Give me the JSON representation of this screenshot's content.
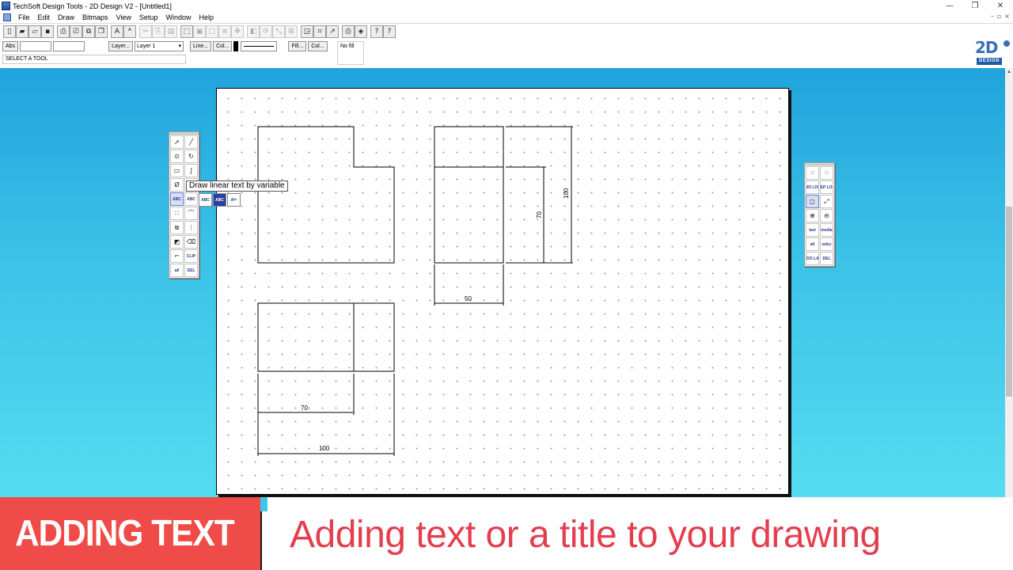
{
  "window": {
    "title": "TechSoft Design Tools - 2D Design V2 - [Untitled1]",
    "controls": [
      "—",
      "❐",
      "✕"
    ],
    "mdi_controls": [
      "–",
      "▫",
      "×"
    ]
  },
  "menu": [
    "File",
    "Edit",
    "Draw",
    "Bitmaps",
    "View",
    "Setup",
    "Window",
    "Help"
  ],
  "toolbar": {
    "icons": [
      "new-icon",
      "open-icon",
      "open-folder-icon",
      "save-icon",
      "print-icon",
      "print-preview-icon",
      "copy-view-icon",
      "copy-icon",
      "font-icon",
      "text-style-icon",
      "cut-icon",
      "copy-clip-icon",
      "paste-icon",
      "select-all-icon",
      "group-icon",
      "ungroup-icon",
      "align-icon",
      "move-icon",
      "mirror-icon",
      "rotate-icon",
      "scale-icon",
      "array-icon",
      "zoom-fit-icon",
      "grid-icon",
      "measure-icon",
      "print-setup-icon",
      "cad-icon",
      "context-help-icon",
      "help-icon"
    ]
  },
  "propbar": {
    "abs_label": "Abs",
    "layer_button": "Layer...",
    "layer_value": "Layer 1",
    "line_button": "Line...",
    "colour_button": "Col...",
    "fill_button": "Fill...",
    "fill_colour_button": "Col...",
    "fill_value": "No fill"
  },
  "status": "SELECT A TOOL",
  "logo": {
    "text": "2D",
    "sub": "DESIGN"
  },
  "tooltip": "Draw linear text by variable",
  "dimensions": {
    "d1": "50",
    "d2": "70",
    "d3": "100",
    "d4": "70",
    "d5": "100"
  },
  "left_palette": {
    "tools": [
      {
        "name": "select-arrow-icon",
        "glyph": "➚"
      },
      {
        "name": "line-icon",
        "glyph": "╱"
      },
      {
        "name": "circle-icon",
        "glyph": "⊙"
      },
      {
        "name": "arc-icon",
        "glyph": "↻"
      },
      {
        "name": "rectangle-icon",
        "glyph": "▭"
      },
      {
        "name": "curve-icon",
        "glyph": "∫"
      },
      {
        "name": "text-tool-icon",
        "glyph": "Ø"
      },
      {
        "name": "hatch-icon",
        "glyph": "▦"
      },
      {
        "name": "abc-text-icon",
        "glyph": "ABC"
      },
      {
        "name": "abc-variable-text-icon",
        "glyph": "ABC"
      },
      {
        "name": "points-icon",
        "glyph": "∷"
      },
      {
        "name": "fillet-icon",
        "glyph": "⌒"
      },
      {
        "name": "copy-shape-icon",
        "glyph": "⧉"
      },
      {
        "name": "distribute-icon",
        "glyph": "⋮"
      },
      {
        "name": "fill-colour-icon",
        "glyph": "◩"
      },
      {
        "name": "eraser-icon",
        "glyph": "⌫"
      },
      {
        "name": "trim-icon",
        "glyph": "⌐"
      },
      {
        "name": "clip-icon",
        "glyph": "CLIP"
      },
      {
        "name": "delete-all-icon",
        "glyph": "all"
      },
      {
        "name": "delete-icon",
        "glyph": "DEL"
      }
    ],
    "flyout": [
      {
        "name": "abc-outline-text-icon",
        "glyph": "ABC"
      },
      {
        "name": "abc-filled-text-icon",
        "glyph": "ABC"
      },
      {
        "name": "abc-cursor-text-icon",
        "glyph": "Aᴮᶜ"
      }
    ]
  },
  "right_palette": {
    "tools": [
      {
        "name": "grid-points-icon",
        "glyph": "⁙"
      },
      {
        "name": "paint-icon",
        "glyph": "♢"
      },
      {
        "name": "grid-lock-icon",
        "glyph": "GRID LOCK"
      },
      {
        "name": "step-lock-icon",
        "glyph": "STEP LOCK"
      },
      {
        "name": "window-icon",
        "glyph": "◻"
      },
      {
        "name": "zoom-window-icon",
        "glyph": "⤢"
      },
      {
        "name": "zoom-in-icon",
        "glyph": "⊕"
      },
      {
        "name": "zoom-out-icon",
        "glyph": "⊖"
      },
      {
        "name": "last-icon",
        "glyph": "last"
      },
      {
        "name": "media-icon",
        "glyph": "media"
      },
      {
        "name": "select-all-icon",
        "glyph": "all"
      },
      {
        "name": "select-icon",
        "glyph": "selec"
      },
      {
        "name": "undo-last-icon",
        "glyph": "UNDO LAST"
      },
      {
        "name": "delete-last-icon",
        "glyph": "DEL"
      }
    ]
  },
  "banner": {
    "tag": "ADDING TEXT",
    "caption": "Adding text or a title to your drawing"
  },
  "colors": {
    "banner_red": "#ef4b48",
    "caption_red": "#e23f4f",
    "workspace_top": "#21a3dc",
    "workspace_bottom": "#55dcf0"
  }
}
